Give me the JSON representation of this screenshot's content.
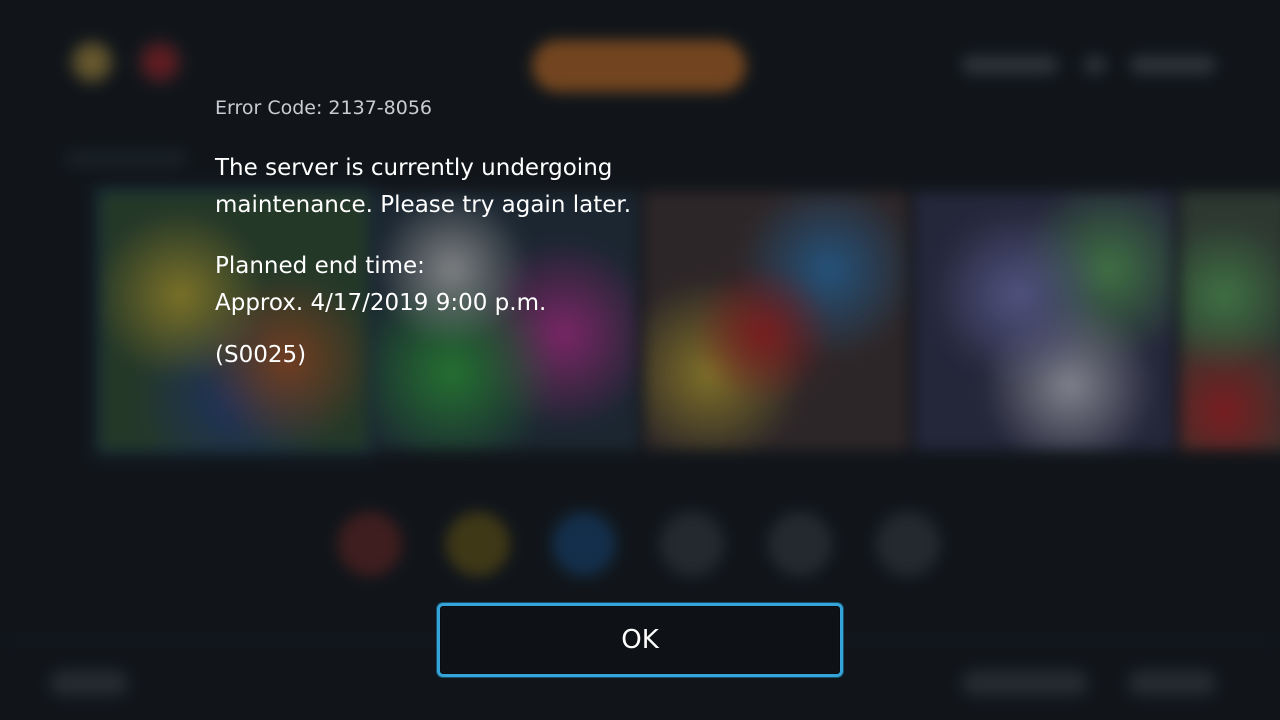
{
  "dialog": {
    "error_code": "Error Code: 2137-8056",
    "message_line1": "The server is currently undergoing",
    "message_line2": "maintenance. Please try again later.",
    "end_time_label": "Planned end time:",
    "end_time_value": "Approx. 4/17/2019 9:00 p.m.",
    "reference_code": "(S0025)",
    "ok_label": "OK"
  },
  "colors": {
    "background": "#171b20",
    "text": "#ffffff",
    "error_code_text": "#c9ccd0",
    "button_border": "#36a4d8",
    "button_fill": "#0e1217"
  }
}
